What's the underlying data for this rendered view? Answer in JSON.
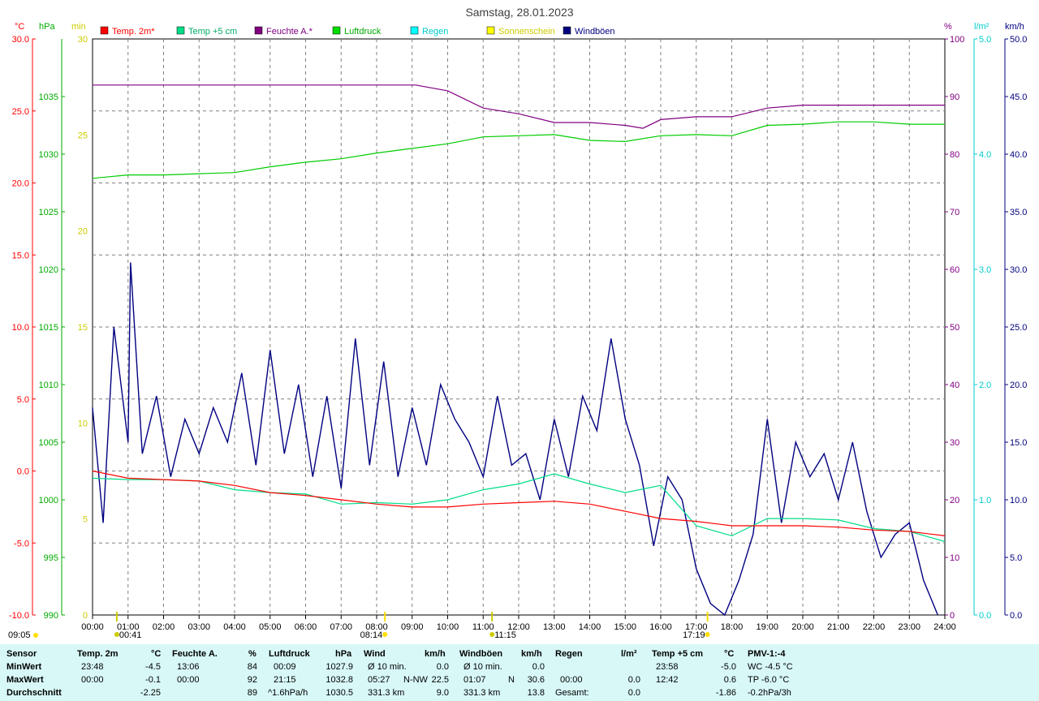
{
  "title": "Samstag, 28.01.2023",
  "colors": {
    "temp2m": "#ff0000",
    "temp5cm": "#00dd88",
    "humidity": "#800080",
    "pressure": "#00cc00",
    "rain": "#00dddd",
    "sunshine": "#dddd00",
    "gusts": "#000080"
  },
  "legend": [
    {
      "label": "Temp. 2m*",
      "color": "#ff0000",
      "text_color": "#ff0000"
    },
    {
      "label": "Temp +5 cm",
      "color": "#00dd88",
      "text_color": "#00aa66"
    },
    {
      "label": "Feuchte A.*",
      "color": "#800080",
      "text_color": "#800080"
    },
    {
      "label": "Luftdruck",
      "color": "#00dd00",
      "text_color": "#00aa00"
    },
    {
      "label": "Regen",
      "color": "#00ffff",
      "text_color": "#00cccc"
    },
    {
      "label": "Sonnenschein",
      "color": "#ffff00",
      "text_color": "#cccc00"
    },
    {
      "label": "Windböen",
      "color": "#000080",
      "text_color": "#000080"
    }
  ],
  "axes": {
    "temp": {
      "unit": "°C",
      "ticks": [
        "30.0",
        "25.0",
        "20.0",
        "15.0",
        "10.0",
        "5.0",
        "0.0",
        "-5.0",
        "-10.0"
      ],
      "range": [
        -10,
        30
      ]
    },
    "pressure": {
      "unit": "hPa",
      "ticks": [
        "1035",
        "1030",
        "1025",
        "1020",
        "1015",
        "1010",
        "1005",
        "1000",
        "995",
        "990"
      ],
      "range": [
        990,
        1040
      ]
    },
    "sunshine": {
      "unit": "min",
      "ticks": [
        "30",
        "25",
        "20",
        "15",
        "10",
        "5",
        "0"
      ],
      "range": [
        0,
        30
      ]
    },
    "humidity": {
      "unit": "%",
      "ticks": [
        "100",
        "90",
        "80",
        "70",
        "60",
        "50",
        "40",
        "30",
        "20",
        "10",
        "0"
      ],
      "range": [
        0,
        100
      ]
    },
    "rain": {
      "unit": "l/m²",
      "ticks": [
        "5.0",
        "4.0",
        "3.0",
        "2.0",
        "1.0",
        "0.0"
      ],
      "range": [
        0,
        5
      ]
    },
    "wind": {
      "unit": "km/h",
      "ticks": [
        "50.0",
        "45.0",
        "40.0",
        "35.0",
        "30.0",
        "25.0",
        "20.0",
        "15.0",
        "10.0",
        "5.0",
        "0.0"
      ],
      "range": [
        0,
        50
      ]
    },
    "time_ticks": [
      "00:00",
      "01:00",
      "02:00",
      "03:00",
      "04:00",
      "05:00",
      "06:00",
      "07:00",
      "08:00",
      "09:00",
      "10:00",
      "11:00",
      "12:00",
      "13:00",
      "14:00",
      "15:00",
      "16:00",
      "17:00",
      "18:00",
      "19:00",
      "20:00",
      "21:00",
      "22:00",
      "23:00",
      "24:00"
    ]
  },
  "markers": {
    "moonset": "00:41",
    "sunrise": "08:14",
    "moonrise": "11:15",
    "sunset": "17:19",
    "moonlabel_left": "09:05"
  },
  "chart_data": {
    "type": "line",
    "x_unit": "hours",
    "series": [
      {
        "name": "Temp. 2m*",
        "axis": "temp",
        "x": [
          0,
          1,
          2,
          3,
          4,
          5,
          6,
          7,
          8,
          9,
          10,
          11,
          12,
          13,
          14,
          15,
          16,
          17,
          18,
          19,
          20,
          21,
          22,
          23,
          24
        ],
        "y": [
          0,
          -0.5,
          -0.6,
          -0.7,
          -1.0,
          -1.5,
          -1.7,
          -2.0,
          -2.3,
          -2.5,
          -2.5,
          -2.3,
          -2.2,
          -2.1,
          -2.3,
          -2.8,
          -3.3,
          -3.5,
          -3.8,
          -3.8,
          -3.8,
          -3.9,
          -4.1,
          -4.2,
          -4.5
        ]
      },
      {
        "name": "Temp +5 cm",
        "axis": "temp",
        "x": [
          0,
          1,
          2,
          3,
          4,
          5,
          6,
          7,
          8,
          9,
          10,
          11,
          12,
          13,
          14,
          15,
          16,
          17,
          18,
          19,
          20,
          21,
          22,
          23,
          24
        ],
        "y": [
          -0.5,
          -0.6,
          -0.6,
          -0.7,
          -1.3,
          -1.5,
          -1.6,
          -2.3,
          -2.2,
          -2.3,
          -2.0,
          -1.3,
          -0.9,
          -0.2,
          -0.9,
          -1.5,
          -1.0,
          -3.8,
          -4.5,
          -3.3,
          -3.3,
          -3.4,
          -4.0,
          -4.2,
          -4.9
        ]
      },
      {
        "name": "Feuchte A.*",
        "axis": "humidity",
        "x": [
          0,
          1,
          2,
          3,
          4,
          5,
          6,
          7,
          8,
          9,
          9.1,
          10,
          11,
          12,
          13,
          14,
          15,
          15.5,
          16,
          17,
          18,
          19,
          20,
          21,
          22,
          23,
          24
        ],
        "y": [
          92,
          92,
          92,
          92,
          92,
          92,
          92,
          92,
          92,
          92,
          92,
          91,
          88,
          87,
          85.5,
          85.5,
          85,
          84.5,
          86,
          86.5,
          86.5,
          88,
          88.5,
          88.5,
          88.5,
          88.5,
          88.5
        ]
      },
      {
        "name": "Luftdruck",
        "axis": "pressure",
        "x": [
          0,
          1,
          2,
          3,
          4,
          5,
          6,
          7,
          8,
          9,
          10,
          11,
          12,
          13,
          14,
          15,
          16,
          17,
          18,
          19,
          20,
          21,
          22,
          23,
          24
        ],
        "y": [
          1027.9,
          1028.2,
          1028.2,
          1028.3,
          1028.4,
          1028.9,
          1029.3,
          1029.6,
          1030.1,
          1030.5,
          1030.9,
          1031.5,
          1031.6,
          1031.7,
          1031.2,
          1031.1,
          1031.6,
          1031.7,
          1031.6,
          1032.5,
          1032.6,
          1032.8,
          1032.8,
          1032.6,
          1032.6
        ]
      },
      {
        "name": "Windböen",
        "axis": "wind",
        "x": [
          0,
          0.3,
          0.6,
          1.0,
          1.07,
          1.4,
          1.8,
          2.2,
          2.6,
          3.0,
          3.4,
          3.8,
          4.2,
          4.6,
          5.0,
          5.4,
          5.8,
          6.2,
          6.6,
          7.0,
          7.4,
          7.8,
          8.2,
          8.6,
          9.0,
          9.4,
          9.8,
          10.2,
          10.6,
          11.0,
          11.4,
          11.8,
          12.2,
          12.6,
          13.0,
          13.4,
          13.8,
          14.2,
          14.6,
          15.0,
          15.4,
          15.8,
          16.2,
          16.6,
          17.0,
          17.4,
          17.8,
          18.2,
          18.6,
          19.0,
          19.4,
          19.8,
          20.2,
          20.6,
          21.0,
          21.4,
          21.8,
          22.2,
          22.6,
          23.0,
          23.4,
          23.8
        ],
        "y": [
          18,
          8,
          25,
          15,
          30.6,
          14,
          19,
          12,
          17,
          14,
          18,
          15,
          21,
          13,
          23,
          14,
          20,
          12,
          19,
          11,
          24,
          13,
          22,
          12,
          18,
          13,
          20,
          17,
          15,
          12,
          19,
          13,
          14,
          10,
          17,
          12,
          19,
          16,
          24,
          17,
          13,
          6,
          12,
          10,
          4,
          1,
          0,
          3,
          7,
          17,
          8,
          15,
          12,
          14,
          10,
          15,
          9,
          5,
          7,
          8,
          3,
          0
        ]
      }
    ],
    "temp_ylim": [
      -10,
      30
    ],
    "humidity_ylim": [
      0,
      100
    ],
    "pressure_ylim": [
      990,
      1040
    ],
    "wind_ylim": [
      0,
      50
    ],
    "xlim": [
      0,
      24
    ],
    "grid": true,
    "legend_position": "top"
  },
  "stats": {
    "headers": {
      "sensor": "Sensor",
      "temp2m": "Temp. 2m",
      "temp2m_unit": "°C",
      "humidity": "Feuchte A.",
      "humidity_unit": "%",
      "pressure": "Luftdruck",
      "pressure_unit": "hPa",
      "wind": "Wind",
      "wind_unit": "km/h",
      "gusts": "Windböen",
      "gusts_unit": "km/h",
      "rain": "Regen",
      "rain_unit": "l/m²",
      "temp5cm": "Temp +5 cm",
      "temp5cm_unit": "°C",
      "pmv": "PMV-1:-4"
    },
    "rows": {
      "min_label": "MinWert",
      "max_label": "MaxWert",
      "avg_label": "Durchschnitt"
    },
    "temp2m": {
      "min_time": "23:48",
      "min": "-4.5",
      "max_time": "00:00",
      "max": "-0.1",
      "avg": "-2.25"
    },
    "humidity": {
      "min_time": "13:06",
      "min": "84",
      "max_time": "00:00",
      "max": "92",
      "avg": "89"
    },
    "pressure": {
      "min_time": "00:09",
      "min": "1027.9",
      "max_time": "21:15",
      "max": "1032.8",
      "trend": "^1.6hPa/h",
      "avg": "1030.5"
    },
    "wind": {
      "min_label": "Ø 10 min.",
      "min": "0.0",
      "max_time": "05:27",
      "max_dir": "N-NW",
      "max": "22.5",
      "avg_label": "331.3 km",
      "avg": "9.0"
    },
    "gusts": {
      "min_label": "Ø 10 min.",
      "min": "0.0",
      "max_time": "01:07",
      "max_dir": "N",
      "max": "30.6",
      "avg_label": "331.3 km",
      "avg": "13.8"
    },
    "rain": {
      "max_time": "00:00",
      "max": "0.0",
      "total_label": "Gesamt:",
      "total": "0.0"
    },
    "temp5cm": {
      "min_time": "23:58",
      "min": "-5.0",
      "max_time": "12:42",
      "max": "0.6",
      "avg": "-1.86"
    },
    "pmv": {
      "wc": "WC -4.5 °C",
      "tp": "TP -6.0 °C",
      "trend": "-0.2hPa/3h"
    }
  }
}
